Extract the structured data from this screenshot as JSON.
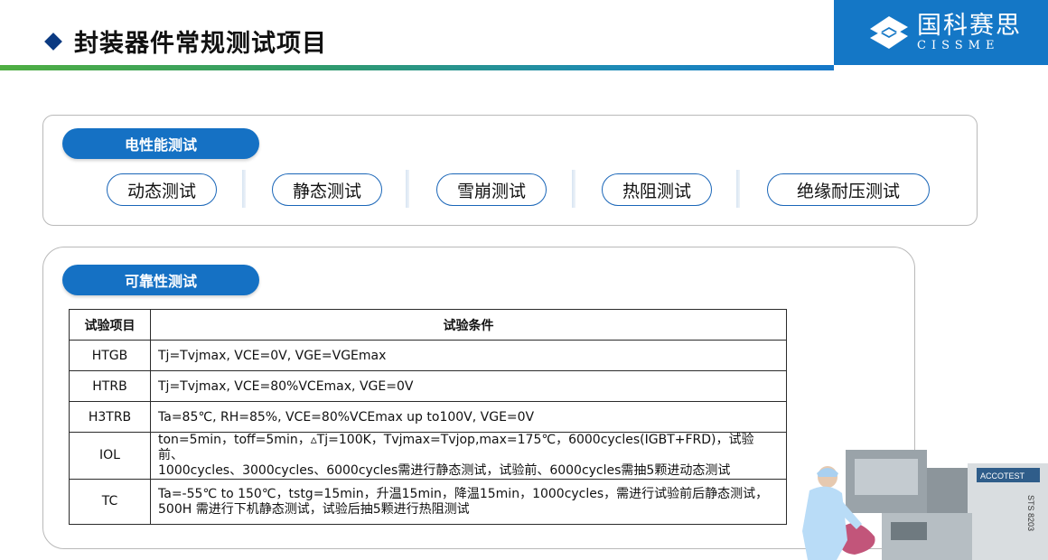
{
  "header": {
    "title": "封装器件常规测试项目",
    "logo_cn": "国科赛思",
    "logo_en": "CISSME"
  },
  "electrical": {
    "section_label": "电性能测试",
    "tests": [
      "动态测试",
      "静态测试",
      "雪崩测试",
      "热阻测试",
      "绝缘耐压测试"
    ]
  },
  "reliability": {
    "section_label": "可靠性测试",
    "table": {
      "headers": [
        "试验项目",
        "试验条件"
      ],
      "rows": [
        {
          "item": "HTGB",
          "condition_lines": [
            "Tj=Tvjmax, VCE=0V, VGE=VGEmax"
          ]
        },
        {
          "item": "HTRB",
          "condition_lines": [
            "Tj=Tvjmax, VCE=80%VCEmax, VGE=0V"
          ]
        },
        {
          "item": "H3TRB",
          "condition_lines": [
            "Ta=85℃, RH=85%, VCE=80%VCEmax up to100V, VGE=0V"
          ]
        },
        {
          "item": "IOL",
          "condition_lines": [
            "ton=5min，toff=5min，▵Tj=100K，Tvjmax=Tvjop,max=175℃，6000cycles(IGBT+FRD)，试验前、",
            "1000cycles、3000cycles、6000cycles需进行静态测试，试验前、6000cycles需抽5颗进动态测试"
          ]
        },
        {
          "item": "TC",
          "condition_lines": [
            "Ta=-55℃ to 150℃，tstg=15min，升温15min，降温15min，1000cycles，需进行试验前后静态测试，",
            "500H 需进行下机静态测试，试验后抽5颗进行热阻测试"
          ]
        }
      ]
    }
  },
  "equipment_labels": {
    "brand": "ACCOTEST",
    "model": "STS 8203"
  },
  "colors": {
    "brand_blue": "#1571c4",
    "title_diamond": "#0b3a82",
    "bar_green": "#4fae42"
  }
}
